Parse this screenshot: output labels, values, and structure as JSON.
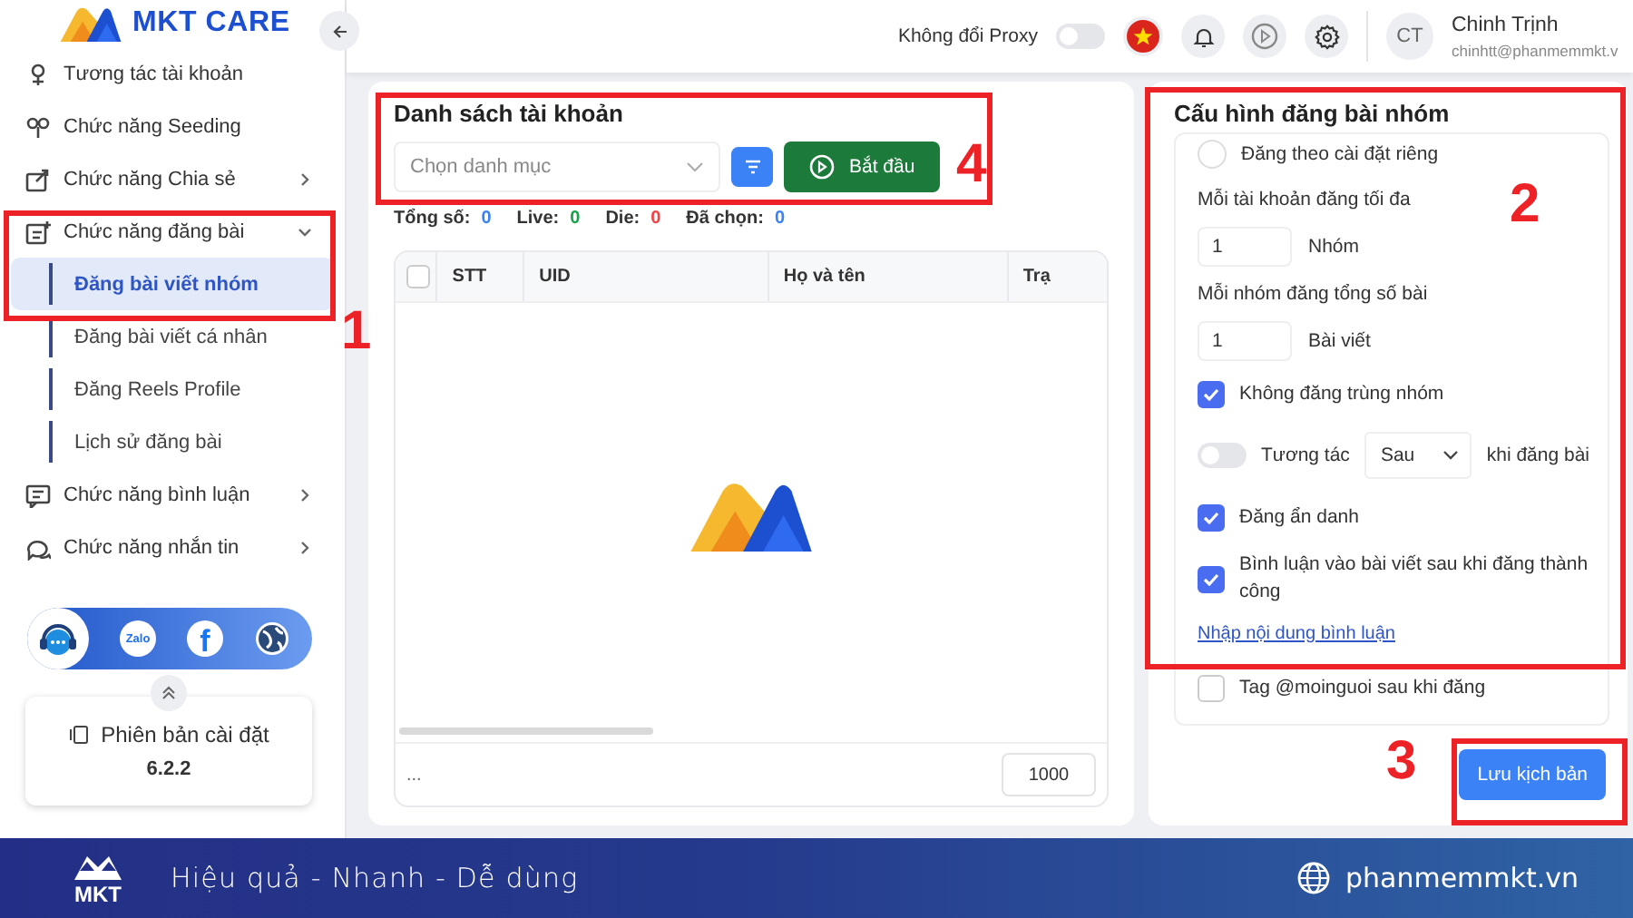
{
  "sidebar": {
    "logo_text": "MKT CARE",
    "items": [
      {
        "label": "Tương tác tài khoản"
      },
      {
        "label": "Chức năng Seeding"
      },
      {
        "label": "Chức năng Chia sẻ",
        "expanded": false
      },
      {
        "label": "Chức năng đăng bài",
        "expanded": true,
        "children": [
          {
            "label": "Đăng bài viết nhóm",
            "selected": true
          },
          {
            "label": "Đăng bài viết cá nhân",
            "selected": false
          },
          {
            "label": "Đăng Reels Profile",
            "selected": false
          },
          {
            "label": "Lịch sử đăng bài",
            "selected": false
          }
        ]
      },
      {
        "label": "Chức năng bình luận",
        "expanded": false
      },
      {
        "label": "Chức năng nhắn tin",
        "expanded": false
      }
    ],
    "social": {
      "zalo": "Zalo",
      "facebook": "f"
    },
    "version": {
      "label": "Phiên bản cài đặt",
      "number": "6.2.2"
    }
  },
  "header": {
    "proxy_label": "Không đổi Proxy",
    "proxy_on": false,
    "avatar": "CT",
    "user_name": "Chinh Trịnh",
    "user_email": "chinhtt@phanmemmkt.v"
  },
  "accounts": {
    "title": "Danh sách tài khoản",
    "category_placeholder": "Chọn danh mục",
    "start_button": "Bắt đầu",
    "stats": [
      {
        "label": "Tổng số:",
        "value": "0",
        "color": "#3b82f6"
      },
      {
        "label": "Live:",
        "value": "0",
        "color": "#16a34a"
      },
      {
        "label": "Die:",
        "value": "0",
        "color": "#ef4444"
      },
      {
        "label": "Đã chọn:",
        "value": "0",
        "color": "#3b82f6"
      }
    ],
    "table": {
      "select_all_checked": false,
      "columns": [
        "STT",
        "UID",
        "Họ và tên",
        "Trạ"
      ]
    },
    "pagination": "...",
    "page_size": "1000"
  },
  "config": {
    "title": "Cấu hình đăng bài nhóm",
    "options": [
      {
        "kind": "radio",
        "label": "Đăng theo cài đặt riêng",
        "selected": false
      },
      {
        "kind": "label",
        "label": "Mỗi tài khoản đăng tối đa"
      },
      {
        "kind": "number",
        "value": "1",
        "unit": "Nhóm"
      },
      {
        "kind": "label",
        "label": "Mỗi nhóm đăng tổng số bài"
      },
      {
        "kind": "number",
        "value": "1",
        "unit": "Bài viết"
      },
      {
        "kind": "checkbox",
        "label": "Không đăng trùng nhóm",
        "checked": true
      },
      {
        "kind": "interact",
        "on": false,
        "label": "Tương tác",
        "value": "Sau",
        "suffix": "khi đăng bài"
      },
      {
        "kind": "checkbox",
        "label": "Đăng ẩn danh",
        "checked": true
      },
      {
        "kind": "checkbox",
        "label": "Bình luận vào bài viết sau khi đăng thành công",
        "checked": true
      },
      {
        "kind": "link",
        "label": "Nhập nội dung bình luận"
      },
      {
        "kind": "checkbox",
        "label": "Tag @moinguoi sau khi đăng",
        "checked": false
      }
    ],
    "save_button": "Lưu kịch bản"
  },
  "callouts": [
    {
      "number": "1"
    },
    {
      "number": "2"
    },
    {
      "number": "3"
    },
    {
      "number": "4"
    }
  ],
  "banner": {
    "logo_text": "MKT",
    "tagline": "Hiệu quả - Nhanh - Dễ dùng",
    "website": "phanmemmkt.vn"
  }
}
